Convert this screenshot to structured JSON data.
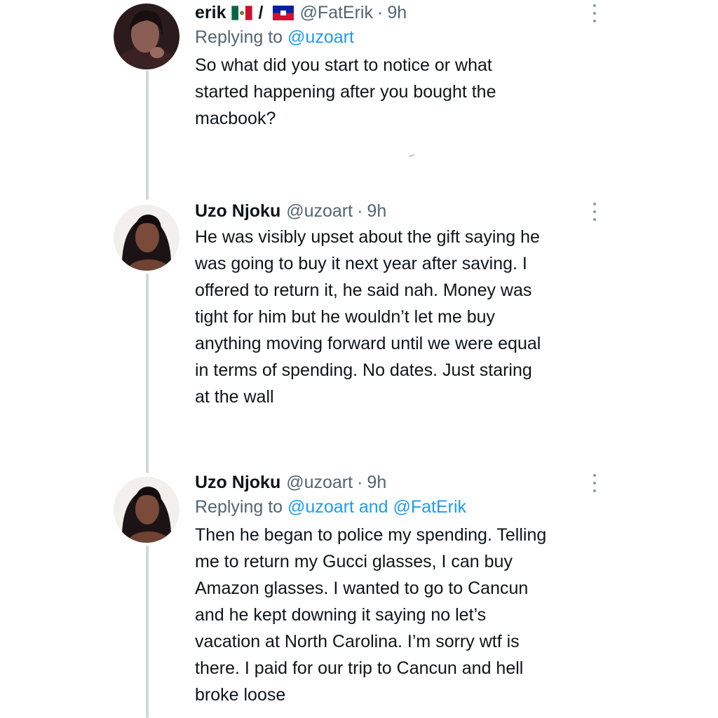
{
  "tweets": [
    {
      "display_name": "erik",
      "separator": "/",
      "handle": "@FatErik",
      "time": "9h",
      "replying_prefix": "Replying to",
      "replying_mentions": "@uzoart",
      "text_lines": [
        "So what did you start to notice or what",
        "started happening after you bought the",
        "macbook?"
      ]
    },
    {
      "display_name": "Uzo Njoku",
      "handle": "@uzoart",
      "time": "9h",
      "text_lines": [
        "He was visibly upset about the gift saying he",
        "was going to buy it next year after saving. I",
        "offered to return it, he said nah. Money was",
        "tight for him but he wouldn’t let me buy",
        "anything moving forward until we were equal",
        "in terms of spending. No dates. Just staring",
        "at the wall"
      ]
    },
    {
      "display_name": "Uzo Njoku",
      "handle": "@uzoart",
      "time": "9h",
      "replying_prefix": "Replying to",
      "replying_mentions": "@uzoart and @FatErik",
      "text_lines": [
        "Then he began to police my spending. Telling",
        "me to return my Gucci glasses, I can buy",
        "Amazon glasses. I wanted to go to Cancun",
        "and he kept downing it saying no let’s",
        "vacation at North Carolina. I’m sorry wtf is",
        "there. I paid for our trip to Cancun and hell",
        "broke loose"
      ]
    }
  ],
  "icons": {
    "flag_1": "mexico-flag-icon",
    "flag_2": "haiti-flag-icon",
    "more": "more-options-icon"
  },
  "colors": {
    "mention": "#1d9bf0",
    "secondary_text": "#536471",
    "thread_line": "#cfd9de"
  }
}
